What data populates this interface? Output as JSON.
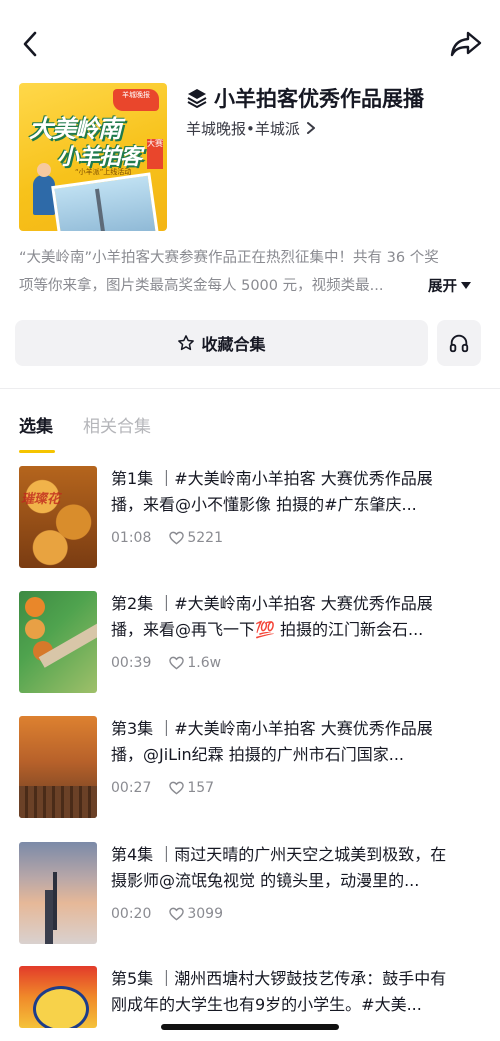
{
  "header": {
    "back_icon": "chevron-left-icon",
    "share_icon": "share-arrow-icon"
  },
  "collection": {
    "title": "小羊拍客优秀作品展播",
    "author": "羊城晚报•羊城派",
    "description_line1": "“大美岭南”小羊拍客大赛参赛作品正在热烈征集中！共有 36 个奖",
    "description_line2": "项等你来拿，图片类最高奖金每人 5000 元，视频类最...",
    "expand_label": "展开",
    "cover_text": {
      "line1": "大美岭南",
      "line2": "小羊拍客",
      "badge": "羊城晚报",
      "tag": "大赛",
      "subtitle": "“小羊派”上线活动"
    }
  },
  "actions": {
    "collect_label": "收藏合集",
    "listen_icon": "headphones-icon"
  },
  "tabs": [
    {
      "label": "选集",
      "active": true
    },
    {
      "label": "相关合集",
      "active": false
    }
  ],
  "episodes": [
    {
      "line1": "第1集 ｜#大美岭南小羊拍客 大赛优秀作品展",
      "line2": "播，来看@小不懂影像 拍摄的#广东肇庆...",
      "duration": "01:08",
      "likes": "5221"
    },
    {
      "line1": "第2集 ｜#大美岭南小羊拍客 大赛优秀作品展",
      "line2": "播，来看@再飞一下💯 拍摄的江门新会石...",
      "duration": "00:39",
      "likes": "1.6w"
    },
    {
      "line1": "第3集 ｜#大美岭南小羊拍客 大赛优秀作品展",
      "line2": "播，@JiLin纪霖  拍摄的广州市石门国家...",
      "duration": "00:27",
      "likes": "157"
    },
    {
      "line1": "第4集 ｜雨过天晴的广州天空之城美到极致，在",
      "line2": "摄影师@流氓兔视觉  的镜头里，动漫里的...",
      "duration": "00:20",
      "likes": "3099"
    },
    {
      "line1": "第5集 ｜潮州西塘村大锣鼓技艺传承：鼓手中有",
      "line2": "刚成年的大学生也有9岁的小学生。#大美..."
    }
  ]
}
